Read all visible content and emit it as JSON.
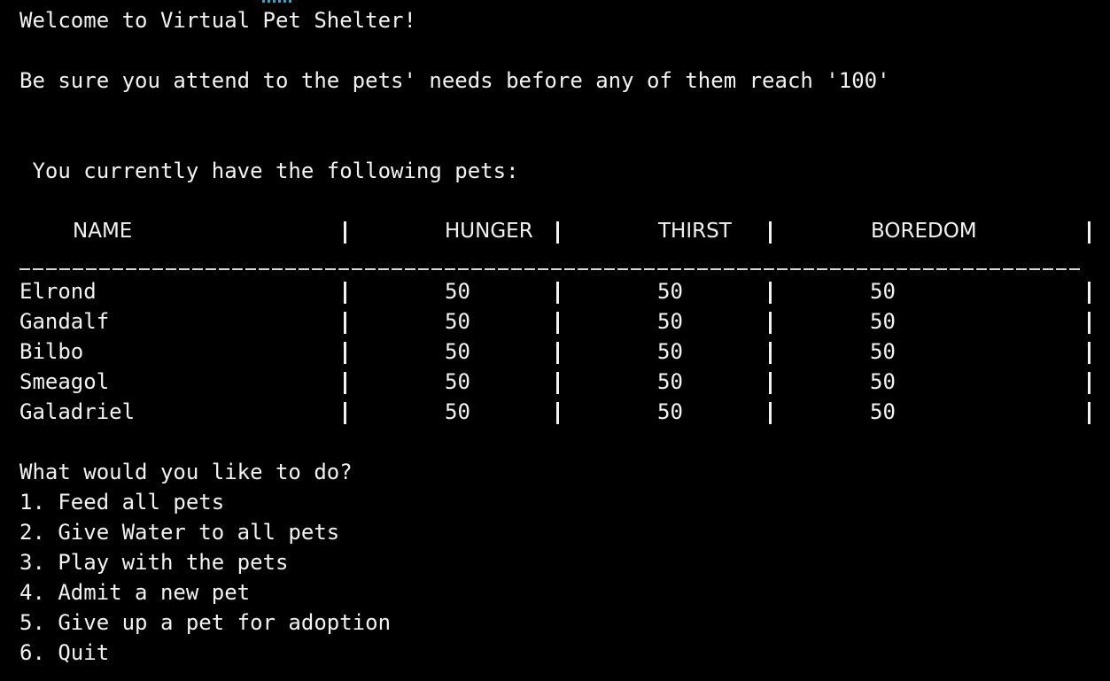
{
  "intro": {
    "welcome": "Welcome to Virtual Pet Shelter!",
    "warning": "Be sure you attend to the pets' needs before any of them reach '100'",
    "pets_heading": " You currently have the following pets:"
  },
  "table": {
    "headers": [
      "NAME",
      "HUNGER",
      "THIRST",
      "BOREDOM"
    ],
    "rows": [
      {
        "name": "Elrond",
        "hunger": "50",
        "thirst": "50",
        "boredom": "50"
      },
      {
        "name": "Gandalf",
        "hunger": "50",
        "thirst": "50",
        "boredom": "50"
      },
      {
        "name": "Bilbo",
        "hunger": "50",
        "thirst": "50",
        "boredom": "50"
      },
      {
        "name": "Smeagol",
        "hunger": "50",
        "thirst": "50",
        "boredom": "50"
      },
      {
        "name": "Galadriel",
        "hunger": "50",
        "thirst": "50",
        "boredom": "50"
      }
    ]
  },
  "menu": {
    "prompt": "What would you like to do?",
    "options": [
      "1. Feed all pets",
      "2. Give Water to all pets",
      "3. Play with the pets",
      "4. Admit a new pet",
      "5. Give up a pet for adoption",
      "6. Quit"
    ]
  },
  "colors": {
    "background": "#000000",
    "foreground": "#f2f2f2"
  }
}
